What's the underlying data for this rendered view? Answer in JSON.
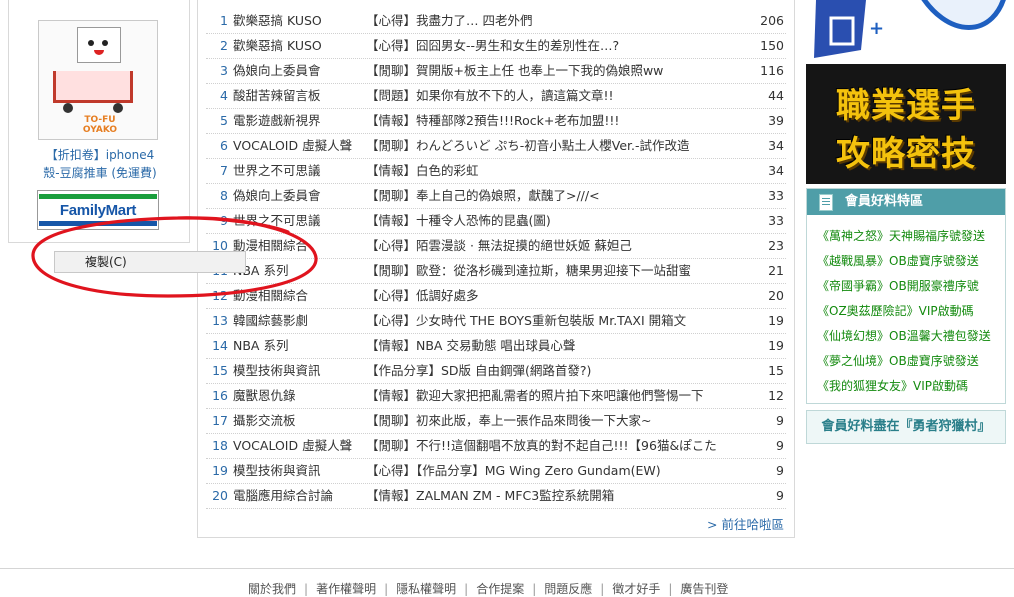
{
  "left_ad": {
    "logo_text": "TO-FU OYAKO",
    "caption_line1": "【折扣卷】iphone4",
    "caption_line2": "殼-豆腐推車 (免運費)",
    "familymart": "FamilyMart"
  },
  "context_menu": {
    "copy_label": "複製(C)"
  },
  "ranking": [
    {
      "rank": "1",
      "board": "歡樂惡搞 KUSO",
      "title": "【心得】我盡力了… 四老外們",
      "count": "206"
    },
    {
      "rank": "2",
      "board": "歡樂惡搞 KUSO",
      "title": "【心得】囧囧男女--男生和女生的差別性在…?",
      "count": "150"
    },
    {
      "rank": "3",
      "board": "偽娘向上委員會",
      "title": "【閒聊】賀開版+板主上任 也奉上一下我的偽娘照ww",
      "count": "116"
    },
    {
      "rank": "4",
      "board": "酸甜苦辣留言板",
      "title": "【問題】如果你有放不下的人，讀這篇文章!!",
      "count": "44"
    },
    {
      "rank": "5",
      "board": "電影遊戲新視界",
      "title": "【情報】特種部隊2預告!!!Rock+老布加盟!!!",
      "count": "39"
    },
    {
      "rank": "6",
      "board": "VOCALOID 虛擬人聲",
      "title": "【閒聊】わんどろいど ぷち-初音小點土人櫻Ver.-試作改造",
      "count": "34"
    },
    {
      "rank": "7",
      "board": "世界之不可思議",
      "title": "【情報】白色的彩虹",
      "count": "34"
    },
    {
      "rank": "8",
      "board": "偽娘向上委員會",
      "title": "【閒聊】奉上自己的偽娘照，獻醜了>///<",
      "count": "33"
    },
    {
      "rank": "9",
      "board": "世界之不可思議",
      "title": "【情報】十種令人恐怖的昆蟲(圖)",
      "count": "33"
    },
    {
      "rank": "10",
      "board": "動漫相關綜合",
      "title": "【心得】陌雲漫談 · 無法捉摸的絕世妖姬 蘇妲己",
      "count": "23"
    },
    {
      "rank": "11",
      "board": "NBA 系列",
      "title": "【閒聊】歐登：從洛杉磯到達拉斯，糖果男迎接下一站甜蜜",
      "count": "21"
    },
    {
      "rank": "12",
      "board": "動漫相關綜合",
      "title": "【心得】低調好處多",
      "count": "20"
    },
    {
      "rank": "13",
      "board": "韓國綜藝影劇",
      "title": "【心得】少女時代 THE BOYS重新包裝版 Mr.TAXI 開箱文",
      "count": "19"
    },
    {
      "rank": "14",
      "board": "NBA 系列",
      "title": "【情報】NBA 交易動態 唱出球員心聲",
      "count": "19"
    },
    {
      "rank": "15",
      "board": "模型技術與資訊",
      "title": "【作品分享】SD版 自由鋼彈(網路首發?)",
      "count": "15"
    },
    {
      "rank": "16",
      "board": "魔獸恩仇錄",
      "title": "【情報】歡迎大家把把亂需者的照片拍下來吧讓他們警惕一下",
      "count": "12"
    },
    {
      "rank": "17",
      "board": "攝影交流板",
      "title": "【閒聊】初來此版，奉上一張作品來問後一下大家~",
      "count": "9"
    },
    {
      "rank": "18",
      "board": "VOCALOID 虛擬人聲",
      "title": "【閒聊】不行!!這個翻唱不放真的對不起自己!!!【96猫&ぽこた",
      "count": "9"
    },
    {
      "rank": "19",
      "board": "模型技術與資訊",
      "title": "【心得】【作品分享】MG Wing Zero Gundam(EW)",
      "count": "9"
    },
    {
      "rank": "20",
      "board": "電腦應用綜合討論",
      "title": "【情報】ZALMAN ZM - MFC3監控系統開箱",
      "count": "9"
    }
  ],
  "more_link": "> 前往哈啦區",
  "right": {
    "banner_line1": "職業選手",
    "banner_line2": "攻略密技",
    "member_title": "會員好料特區",
    "member_items": [
      {
        "game": "《萬神之怒》",
        "desc": "天神賜福序號發送"
      },
      {
        "game": "《越戰風暴》",
        "desc": "OB虛寶序號發送"
      },
      {
        "game": "《帝國爭霸》",
        "desc": "OB開服豪禮序號"
      },
      {
        "game": "《OZ奧茲歷險記》",
        "desc": "VIP啟動碼"
      },
      {
        "game": "《仙境幻想》",
        "desc": "OB溫馨大禮包發送"
      },
      {
        "game": "《夢之仙境》",
        "desc": "OB虛寶序號發送"
      },
      {
        "game": "《我的狐狸女友》",
        "desc": "VIP啟動碼"
      }
    ],
    "member_more": "會員好料盡在『勇者狩獵村』"
  },
  "footer": [
    "關於我們",
    "著作權聲明",
    "隱私權聲明",
    "合作提案",
    "問題反應",
    "徵才好手",
    "廣告刊登"
  ],
  "colors": {
    "link_blue": "#2b6aa8",
    "member_green": "#138a0e",
    "header_teal": "#4f9ea8",
    "annotation_red": "#e0141e"
  }
}
